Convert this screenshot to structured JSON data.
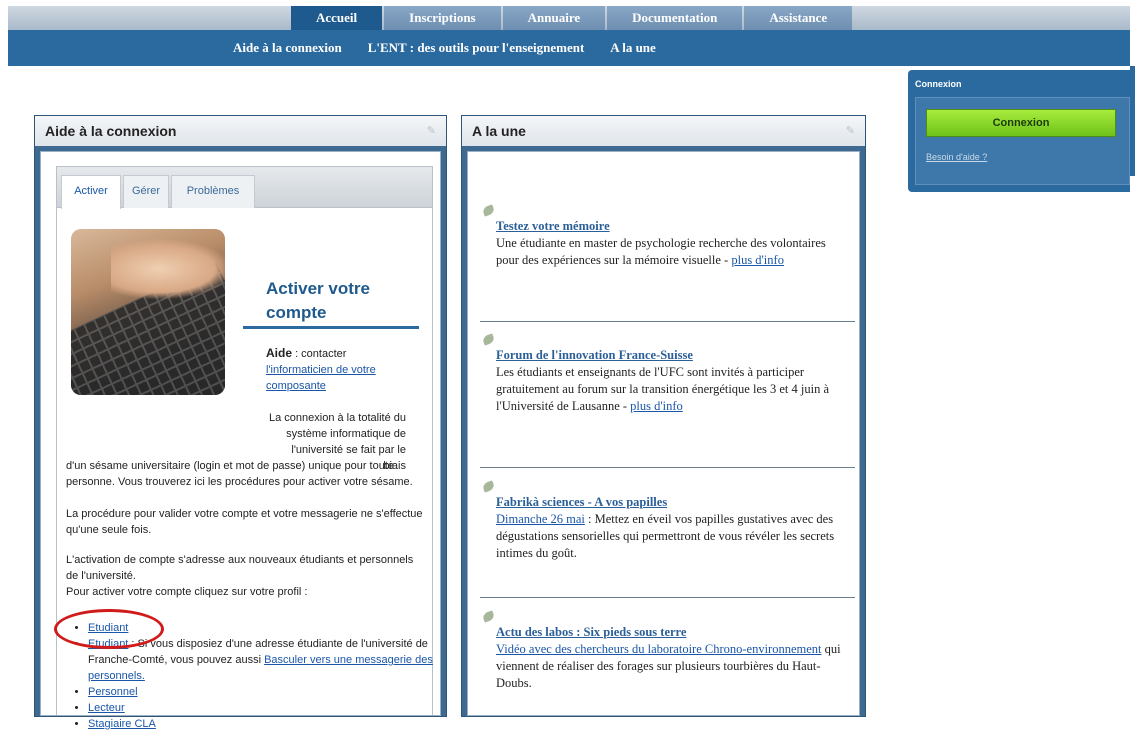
{
  "nav": {
    "tabs": [
      {
        "label": "Accueil",
        "active": true
      },
      {
        "label": "Inscriptions",
        "active": false
      },
      {
        "label": "Annuaire",
        "active": false
      },
      {
        "label": "Documentation",
        "active": false
      },
      {
        "label": "Assistance",
        "active": false
      }
    ],
    "subitems": [
      "Aide à la connexion",
      "L'ENT : des outils pour l'enseignement",
      "A la une"
    ]
  },
  "aide": {
    "header": "Aide à la connexion",
    "tabs": [
      "Activer",
      "Gérer",
      "Problèmes"
    ],
    "active_tab": "Activer",
    "title": "Activer votre compte",
    "aide_label": "Aide",
    "aide_text": " : contacter ",
    "aide_link": "l'informaticien de votre composante",
    "para1_right": "La connexion à la totalité du système informatique de l'université se fait par le biais",
    "para1_rest": "d'un sésame universitaire (login et mot de passe) unique pour toute personne. Vous trouverez ici les procédures pour activer votre sésame.",
    "para2": "La procédure pour valider votre compte et votre messagerie ne s'effectue qu'une seule fois.",
    "para3": "L'activation de compte s'adresse aux nouveaux étudiants et personnels de l'université.",
    "para4": "Pour activer votre compte cliquez sur votre profil :",
    "profiles": {
      "etudiant": "Etudiant",
      "second_link": "Etudiant",
      "second_text": " : Si vous disposiez d'une adresse étudiante de l'université de Franche-Comté, vous pouvez aussi ",
      "second_link2": "Basculer vers une messagerie des personnels.",
      "personnel": "Personnel",
      "lecteur": "Lecteur",
      "stagiaire": "Stagiaire CLA"
    }
  },
  "une": {
    "header": "A la une",
    "items": [
      {
        "title": "Testez votre mémoire",
        "text": "Une étudiante en master de psychologie recherche des volontaires pour des expériences sur la mémoire visuelle - ",
        "link": "plus d'info"
      },
      {
        "title": "Forum de l'innovation France-Suisse",
        "text": "Les étudiants et enseignants de l'UFC sont invités à participer gratuitement au forum sur la transition énergétique les 3 et 4 juin à l'Université de Lausanne - ",
        "link": "plus d'info"
      },
      {
        "title": "Fabrikà sciences - A vos papilles",
        "date": "Dimanche 26 mai",
        "text": " : Mettez en éveil vos papilles gustatives avec des dégustations sensorielles qui permettront de vous révéler les secrets intimes du goût."
      },
      {
        "title": "Actu des labos : Six pieds sous terre",
        "link": "Vidéo avec des chercheurs du laboratoire Chrono-environnement",
        "text": " qui viennent de réaliser des forages sur plusieurs tourbières du Haut-Doubs."
      }
    ]
  },
  "connexion": {
    "title": "Connexion",
    "button": "Connexion",
    "help": "Besoin d'aide ?"
  },
  "colors": {
    "nav_active": "#1f5a8e",
    "nav_bar": "#2b6a9f",
    "button_green": "#8fd82a",
    "highlight_circle": "#d11a1a"
  }
}
